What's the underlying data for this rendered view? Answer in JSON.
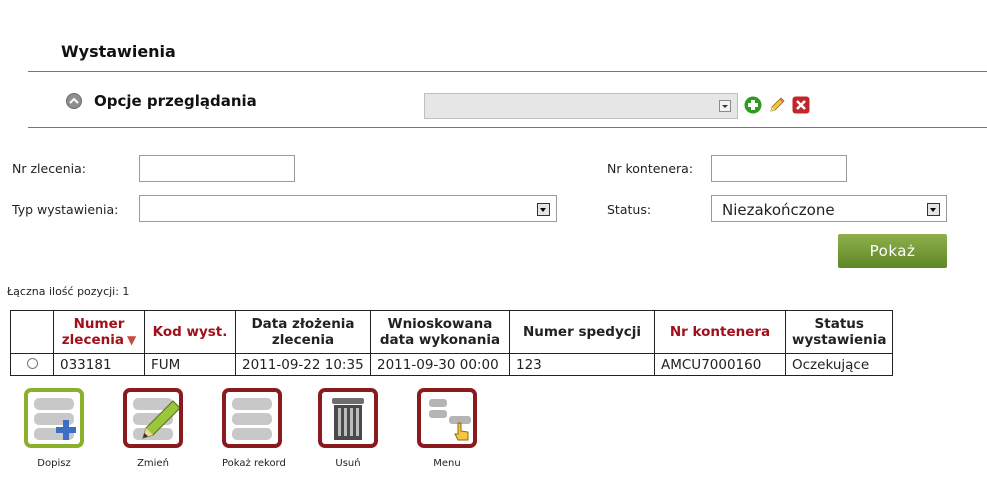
{
  "header": {
    "title": "Wystawienia"
  },
  "options": {
    "label": "Opcje przeglądania",
    "view_select_value": ""
  },
  "filters": {
    "order_no_label": "Nr zlecenia:",
    "order_no_value": "",
    "container_no_label": "Nr kontenera:",
    "container_no_value": "",
    "type_label": "Typ wystawienia:",
    "type_value": "",
    "status_label": "Status:",
    "status_value": "Niezakończone",
    "show_button": "Pokaż"
  },
  "results": {
    "count_text": "Łączna ilość pozycji: 1",
    "columns": {
      "order_no": "Numer zlecenia",
      "code": "Kod wyst.",
      "order_date": "Data złożenia zlecenia",
      "requested_date": "Wnioskowana data wykonania",
      "shipping_no": "Numer spedycji",
      "container_no": "Nr kontenera",
      "status": "Status wystawienia"
    },
    "rows": [
      {
        "order_no": "033181",
        "code": "FUM",
        "order_date": "2011-09-22 10:35",
        "requested_date": "2011-09-30 00:00",
        "shipping_no": "123",
        "container_no": "AMCU7000160",
        "status": "Oczekujące"
      }
    ]
  },
  "actions": {
    "add": "Dopisz",
    "edit": "Zmień",
    "show_record": "Pokaż rekord",
    "delete": "Usuń",
    "menu": "Menu"
  },
  "colors": {
    "accent_red": "#a10f1a",
    "button_green": "#6e9430",
    "tile_border_red": "#8b1a1f",
    "tile_border_green": "#8bb12a"
  }
}
